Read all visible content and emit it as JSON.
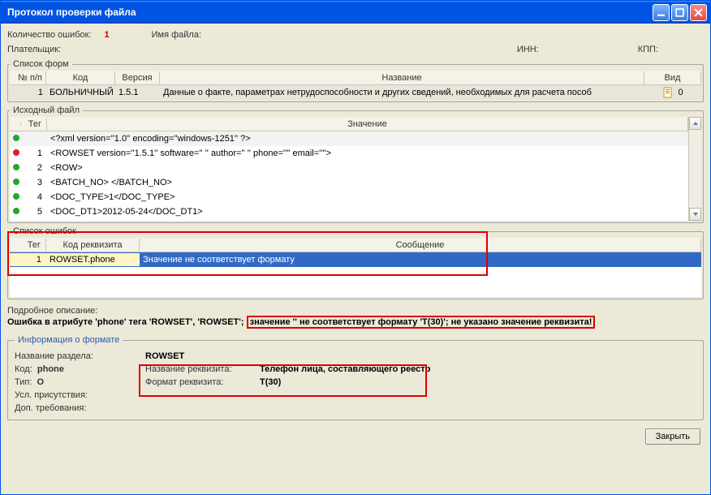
{
  "titlebar": {
    "title": "Протокол проверки файла"
  },
  "header": {
    "errCountLabel": "Количество ошибок:",
    "errCount": "1",
    "fileNameLabel": "Имя файла:",
    "fileName": "",
    "payerLabel": "Плательщик:",
    "payer": "",
    "innLabel": "ИНН:",
    "inn": "",
    "kppLabel": "КПП:",
    "kpp": ""
  },
  "forms": {
    "legend": "Список форм",
    "cols": {
      "np": "№ п/п",
      "code": "Код",
      "ver": "Версия",
      "name": "Название",
      "view": "Вид"
    },
    "rows": [
      {
        "np": "1",
        "code": "БОЛЬНИЧНЫЙ",
        "ver": "1.5.1",
        "name": "Данные о факте, параметрах нетрудоспособности и других сведений, необходимых для расчета пособ",
        "view": "0"
      }
    ]
  },
  "src": {
    "legend": "Исходный файл",
    "cols": {
      "tag": "Тег",
      "val": "Значение"
    },
    "rows": [
      {
        "status": "g",
        "n": "",
        "val": "<?xml version=''1.0'' encoding=''windows-1251'' ?>"
      },
      {
        "status": "r",
        "n": "1",
        "val": "<ROWSET version=''1.5.1'' software=''                    '' author=''                                       '' phone='''' email=''''>"
      },
      {
        "status": "g",
        "n": "2",
        "val": "  <ROW>"
      },
      {
        "status": "g",
        "n": "3",
        "val": "    <BATCH_NO>                                          </BATCH_NO>"
      },
      {
        "status": "g",
        "n": "4",
        "val": "    <DOC_TYPE>1</DOC_TYPE>"
      },
      {
        "status": "g",
        "n": "5",
        "val": "    <DOC_DT1>2012-05-24</DOC_DT1>"
      }
    ]
  },
  "errs": {
    "legend": "Список ошибок",
    "cols": {
      "tag": "Тег",
      "code": "Код реквизита",
      "msg": "Сообщение"
    },
    "rows": [
      {
        "tag": "1",
        "code": "ROWSET.phone",
        "msg": "Значение не соответствует формату"
      }
    ]
  },
  "detail": {
    "label": "Подробное описание:",
    "prefix": "Ошибка в атрибуте 'phone' тега 'ROWSET', 'ROWSET';",
    "emph": "значение '' не соответствует формату 'T(30)'; не указано значение реквизита!"
  },
  "info": {
    "legend": "Информация о формате",
    "sectionLabel": "Название раздела:",
    "section": "ROWSET",
    "codeLabel": "Код:",
    "code": "phone",
    "nameLabel": "Название реквизита:",
    "name": "Телефон лица, составляющего реестр",
    "typeLabel": "Тип:",
    "type": "O",
    "fmtLabel": "Формат реквизита:",
    "fmt": "T(30)",
    "presLabel": "Усл. присутствия:",
    "pres": "",
    "reqLabel": "Доп. требования:",
    "req": ""
  },
  "buttons": {
    "close": "Закрыть"
  }
}
